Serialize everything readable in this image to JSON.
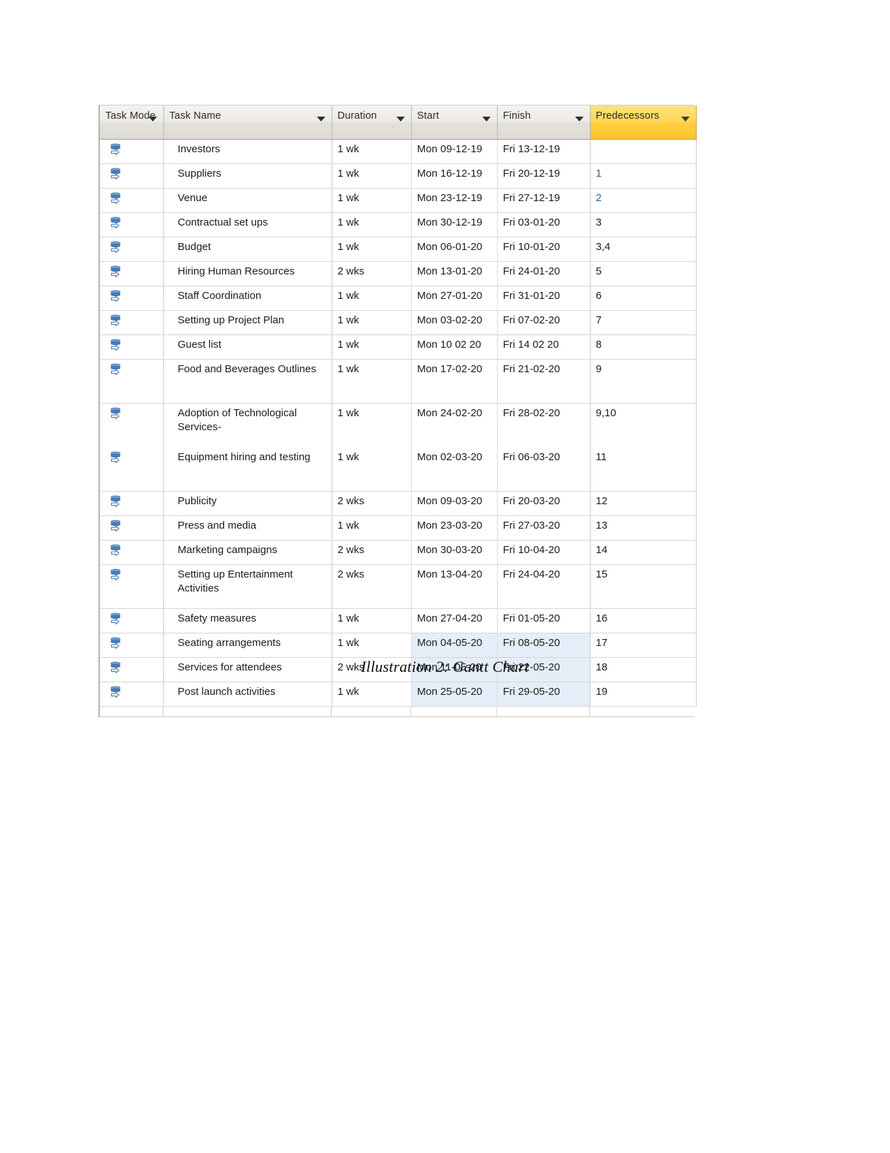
{
  "document": {
    "caption": "Illustration 2: Gantt Chart"
  },
  "table": {
    "columns": [
      {
        "key": "task_mode",
        "label": "Task Mode",
        "filter": true,
        "highlight": false
      },
      {
        "key": "task_name",
        "label": "Task Name",
        "filter": true,
        "highlight": false
      },
      {
        "key": "duration",
        "label": "Duration",
        "filter": true,
        "highlight": false
      },
      {
        "key": "start",
        "label": "Start",
        "filter": true,
        "highlight": false
      },
      {
        "key": "finish",
        "label": "Finish",
        "filter": true,
        "highlight": false
      },
      {
        "key": "predecessors",
        "label": "Predecessors",
        "filter": true,
        "highlight": true
      }
    ],
    "header_highlight_color": "#ffd758",
    "selection_color": "#e4eef8",
    "task_mode_icon": "auto-scheduled-icon",
    "rows": [
      {
        "task_mode": "auto-scheduled-icon",
        "task_name": "Investors",
        "duration": "1 wk",
        "start": "Mon 09-12-19",
        "finish": "Fri 13-12-19",
        "predecessors": ""
      },
      {
        "task_mode": "auto-scheduled-icon",
        "task_name": "Suppliers",
        "duration": "1 wk",
        "start": "Mon 16-12-19",
        "finish": "Fri 20-12-19",
        "predecessors": "1"
      },
      {
        "task_mode": "auto-scheduled-icon",
        "task_name": "Venue",
        "duration": "1 wk",
        "start": "Mon 23-12-19",
        "finish": "Fri 27-12-19",
        "predecessors": "2"
      },
      {
        "task_mode": "auto-scheduled-icon",
        "task_name": "Contractual set ups",
        "duration": "1 wk",
        "start": "Mon 30-12-19",
        "finish": "Fri 03-01-20",
        "predecessors": "3"
      },
      {
        "task_mode": "auto-scheduled-icon",
        "task_name": "Budget",
        "duration": "1 wk",
        "start": "Mon 06-01-20",
        "finish": "Fri 10-01-20",
        "predecessors": "3,4"
      },
      {
        "task_mode": "auto-scheduled-icon",
        "task_name": "Hiring Human Resources",
        "duration": "2 wks",
        "start": "Mon 13-01-20",
        "finish": "Fri 24-01-20",
        "predecessors": "5"
      },
      {
        "task_mode": "auto-scheduled-icon",
        "task_name": "Staff Coordination",
        "duration": "1 wk",
        "start": "Mon 27-01-20",
        "finish": "Fri 31-01-20",
        "predecessors": "6"
      },
      {
        "task_mode": "auto-scheduled-icon",
        "task_name": "Setting up Project Plan",
        "duration": "1 wk",
        "start": "Mon 03-02-20",
        "finish": "Fri 07-02-20",
        "predecessors": "7"
      },
      {
        "task_mode": "auto-scheduled-icon",
        "task_name": "Guest list",
        "duration": "1 wk",
        "start": "Mon 10 02 20",
        "finish": "Fri 14 02 20",
        "predecessors": "8"
      },
      {
        "task_mode": "auto-scheduled-icon",
        "task_name": "Food and Beverages Outlines",
        "duration": "1 wk",
        "start": "Mon 17-02-20",
        "finish": "Fri 21-02-20",
        "predecessors": "9"
      },
      {
        "task_mode": "auto-scheduled-icon",
        "task_name": "Adoption of Technological Services-",
        "duration": "1 wk",
        "start": "Mon 24-02-20",
        "finish": "Fri 28-02-20",
        "predecessors": "9,10"
      },
      {
        "task_mode": "auto-scheduled-icon",
        "task_name": "Equipment hiring and testing",
        "duration": "1 wk",
        "start": "Mon 02-03-20",
        "finish": "Fri 06-03-20",
        "predecessors": "11"
      },
      {
        "task_mode": "auto-scheduled-icon",
        "task_name": "Publicity",
        "duration": "2 wks",
        "start": "Mon 09-03-20",
        "finish": "Fri 20-03-20",
        "predecessors": "12"
      },
      {
        "task_mode": "auto-scheduled-icon",
        "task_name": "Press and media",
        "duration": "1 wk",
        "start": "Mon 23-03-20",
        "finish": "Fri 27-03-20",
        "predecessors": "13"
      },
      {
        "task_mode": "auto-scheduled-icon",
        "task_name": "Marketing campaigns",
        "duration": "2 wks",
        "start": "Mon 30-03-20",
        "finish": "Fri 10-04-20",
        "predecessors": "14"
      },
      {
        "task_mode": "auto-scheduled-icon",
        "task_name": "Setting up Entertainment Activities",
        "duration": "2 wks",
        "start": "Mon 13-04-20",
        "finish": "Fri 24-04-20",
        "predecessors": "15"
      },
      {
        "task_mode": "auto-scheduled-icon",
        "task_name": "Safety measures",
        "duration": "1 wk",
        "start": "Mon 27-04-20",
        "finish": "Fri 01-05-20",
        "predecessors": "16"
      },
      {
        "task_mode": "auto-scheduled-icon",
        "task_name": "Seating arrangements",
        "duration": "1 wk",
        "start": "Mon 04-05-20",
        "finish": "Fri 08-05-20",
        "predecessors": "17"
      },
      {
        "task_mode": "auto-scheduled-icon",
        "task_name": "Services for attendees",
        "duration": "2 wks",
        "start": "Mon 11-05-20",
        "finish": "Fri 22-05-20",
        "predecessors": "18"
      },
      {
        "task_mode": "auto-scheduled-icon",
        "task_name": "Post launch activities",
        "duration": "1 wk",
        "start": "Mon 25-05-20",
        "finish": "Fri 29-05-20",
        "predecessors": "19"
      }
    ]
  }
}
